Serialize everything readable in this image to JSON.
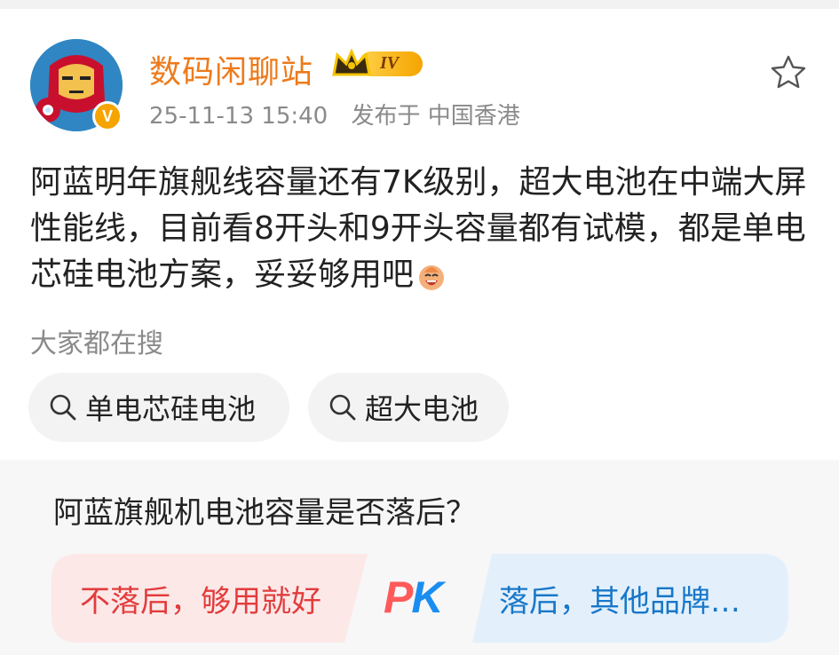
{
  "post": {
    "username": "数码闲聊站",
    "rank_level": "IV",
    "timestamp": "25-11-13 15:40",
    "location": "发布于 中国香港",
    "text": "阿蓝明年旗舰线容量还有7K级别，超大电池在中端大屏性能线，目前看8开头和9开头容量都有试模，都是单电芯硅电池方案，妥妥够用吧",
    "verified_badge": "V"
  },
  "search": {
    "title": "大家都在搜",
    "chips": [
      {
        "label": "单电芯硅电池",
        "icon": "search-icon"
      },
      {
        "label": "超大电池",
        "icon": "search-icon"
      }
    ]
  },
  "poll": {
    "question": "阿蓝旗舰机电池容量是否落后？",
    "option_left": "不落后，够用就好",
    "option_right": "落后，其他品牌…",
    "vs_p": "P",
    "vs_k": "K",
    "colors": {
      "left": "#e23c3c",
      "right": "#1877c9",
      "left_bg": "#fde8e8",
      "right_bg": "#e3f0fc"
    }
  },
  "icons": {
    "favorite": "star-outline-icon",
    "emoji": "laughing-emoji-icon",
    "rank": "crown-icon"
  }
}
